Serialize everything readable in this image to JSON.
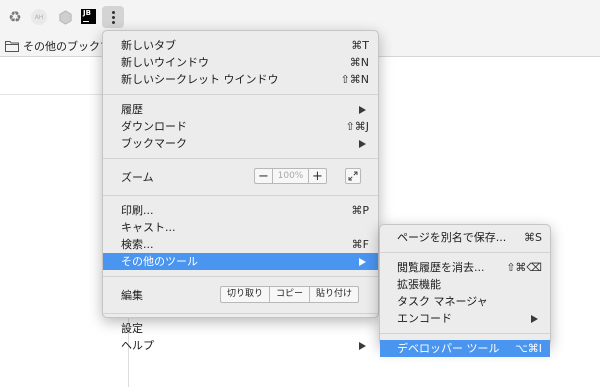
{
  "toolbar": {
    "extensions": [
      {
        "icon": "recycle-icon",
        "glyph": "♻"
      },
      {
        "icon": "ah-extension-icon",
        "text": "AH"
      },
      {
        "icon": "hexagon-extension-icon"
      },
      {
        "icon": "jetbrains-icon",
        "text": "JB"
      }
    ],
    "menu_icon": "kebab-menu-icon"
  },
  "bookmarks_bar": {
    "folder_label": "その他のブックマーク"
  },
  "main_menu": {
    "new_tab": {
      "label": "新しいタブ",
      "shortcut": "⌘T"
    },
    "new_window": {
      "label": "新しいウインドウ",
      "shortcut": "⌘N"
    },
    "new_incognito": {
      "label": "新しいシークレット ウインドウ",
      "shortcut": "⇧⌘N"
    },
    "history": {
      "label": "履歴"
    },
    "downloads": {
      "label": "ダウンロード",
      "shortcut": "⇧⌘J"
    },
    "bookmarks": {
      "label": "ブックマーク"
    },
    "zoom": {
      "label": "ズーム",
      "minus": "−",
      "value": "100%",
      "plus": "+"
    },
    "print": {
      "label": "印刷...",
      "shortcut": "⌘P"
    },
    "cast": {
      "label": "キャスト..."
    },
    "find": {
      "label": "検索...",
      "shortcut": "⌘F"
    },
    "more_tools": {
      "label": "その他のツール",
      "selected": true
    },
    "edit": {
      "label": "編集",
      "cut": "切り取り",
      "copy": "コピー",
      "paste": "貼り付け"
    },
    "settings": {
      "label": "設定"
    },
    "help": {
      "label": "ヘルプ"
    }
  },
  "sub_menu": {
    "save_page_as": {
      "label": "ページを別名で保存...",
      "shortcut": "⌘S"
    },
    "clear_browsing": {
      "label": "閲覧履歴を消去...",
      "shortcut": "⇧⌘⌫"
    },
    "extensions": {
      "label": "拡張機能"
    },
    "task_manager": {
      "label": "タスク マネージャ"
    },
    "encoding": {
      "label": "エンコード"
    },
    "developer_tools": {
      "label": "デベロッパー ツール",
      "shortcut": "⌥⌘I",
      "selected": true
    }
  },
  "colors": {
    "selection": "#4a95f0",
    "menu_background": "#ececec",
    "toolbar_background": "#f4f4f4"
  }
}
